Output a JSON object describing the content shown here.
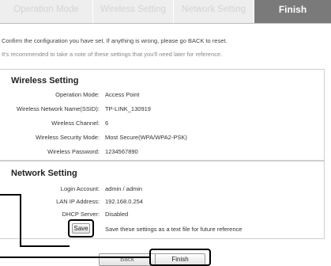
{
  "tabs": [
    "Operation Mode",
    "Wireless Setting",
    "Network Setting",
    "Finish"
  ],
  "intro": {
    "line1": "Confirm the configuration you have set. If anything is wrong, please go BACK to reset.",
    "line2": "It's recommended to take a note of these settings that you'll need later for reference."
  },
  "wireless": {
    "title": "Wireless Setting",
    "rows": [
      {
        "label": "Operation Mode:",
        "value": "Access Point"
      },
      {
        "label": "Wireless Network Name(SSID):",
        "value": "TP-LINK_130919"
      },
      {
        "label": "Wireless Channel:",
        "value": "6"
      },
      {
        "label": "Wireless Security Mode:",
        "value": "Most Secure(WPA/WPA2-PSK)"
      },
      {
        "label": "Wireless Password:",
        "value": "1234567890"
      }
    ]
  },
  "network": {
    "title": "Network Setting",
    "rows": [
      {
        "label": "Login Account:",
        "value": "admin / admin"
      },
      {
        "label": "LAN IP Address:",
        "value": "192.168.0.254"
      },
      {
        "label": "DHCP Server:",
        "value": "Disabled"
      }
    ],
    "save_label": "Save",
    "save_note": "Save these settings as a text file for future reference"
  },
  "footer": {
    "back_label": "Back",
    "finish_label": "Finish"
  }
}
